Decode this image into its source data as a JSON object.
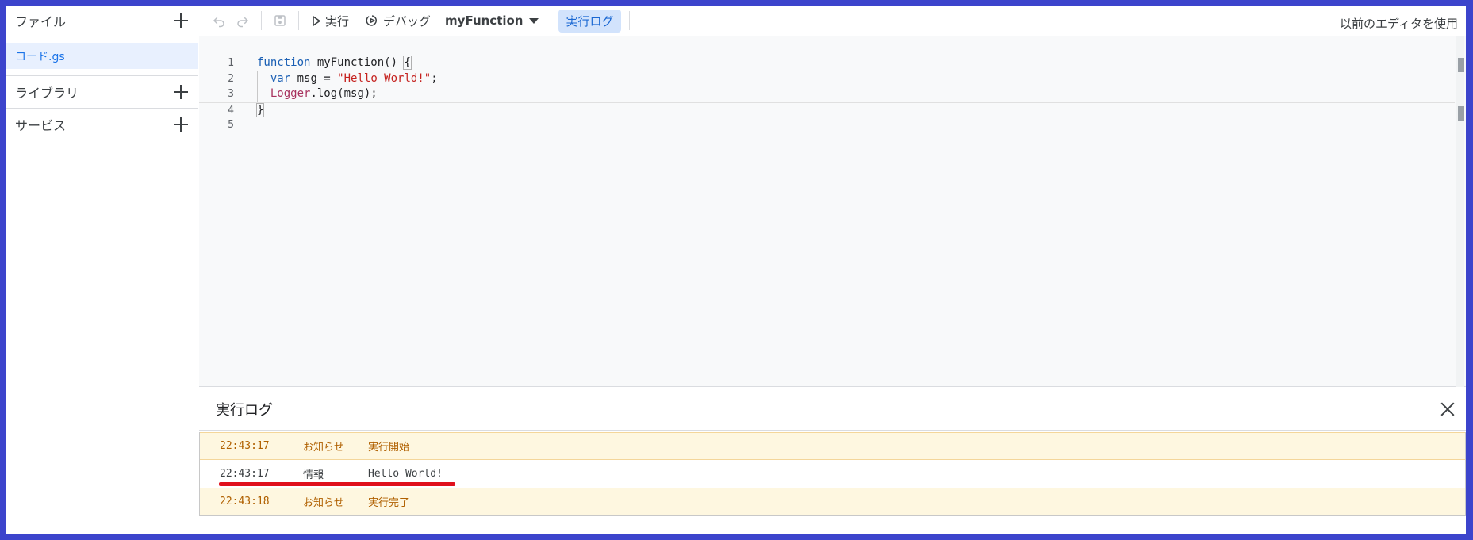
{
  "sidebar": {
    "files_label": "ファイル",
    "file_item": "コード.gs",
    "libraries_label": "ライブラリ",
    "services_label": "サービス"
  },
  "toolbar": {
    "undo_icon": "undo-icon",
    "redo_icon": "redo-icon",
    "save_icon": "save-icon",
    "run_label": "実行",
    "debug_label": "デバッグ",
    "function_select": "myFunction",
    "log_toggle": "実行ログ",
    "legacy_editor": "以前のエディタを使用"
  },
  "editor": {
    "line_numbers": [
      "1",
      "2",
      "3",
      "4",
      "5"
    ],
    "lines": [
      {
        "kw": "function",
        "rest": " myFunction() ",
        "bracket": "{"
      },
      {
        "indent": "  ",
        "kw": "var",
        "mid": " msg = ",
        "str": "\"Hello World!\"",
        "end": ";"
      },
      {
        "indent": "  ",
        "obj": "Logger",
        "rest": ".log(msg);"
      },
      {
        "bracket": "}"
      },
      {}
    ]
  },
  "log_panel": {
    "title": "実行ログ",
    "rows": [
      {
        "time": "22:43:17",
        "type": "お知らせ",
        "message": "実行開始",
        "level": "notice"
      },
      {
        "time": "22:43:17",
        "type": "情報",
        "message": "Hello World!",
        "level": "info"
      },
      {
        "time": "22:43:18",
        "type": "お知らせ",
        "message": "実行完了",
        "level": "notice"
      }
    ]
  },
  "colors": {
    "border_frame": "#3c44cc",
    "accent": "#1a73e8",
    "highlight_red": "#e0101c",
    "notice_bg": "#fef7e0"
  }
}
